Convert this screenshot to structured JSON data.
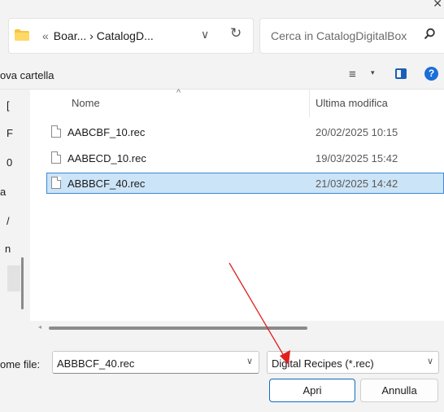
{
  "address": {
    "overflow_glyph": "«",
    "path": "Boar... › CatalogD...",
    "dropdown_glyph": "∨",
    "refresh_glyph": "↻"
  },
  "search": {
    "placeholder": "Cerca in CatalogDigitalBox",
    "icon": "search-icon"
  },
  "toolbar": {
    "new_folder_label": "ova cartella",
    "view_glyph": "≡",
    "view_dropdown_glyph": "▾",
    "help_glyph": "?"
  },
  "nav": {
    "items": [
      "[",
      "F",
      "0",
      "a",
      "/",
      "n"
    ]
  },
  "columns": {
    "name": "Nome",
    "date": "Ultima modifica",
    "sort_glyph": "^"
  },
  "files": [
    {
      "name": "AABCBF_10.rec",
      "date": "20/02/2025 10:15",
      "selected": false
    },
    {
      "name": "AABECD_10.rec",
      "date": "19/03/2025 15:42",
      "selected": false
    },
    {
      "name": "ABBBCF_40.rec",
      "date": "21/03/2025 14:42",
      "selected": true
    }
  ],
  "scroll": {
    "left_glyph": "◂"
  },
  "footer": {
    "file_name_label": "ome file:",
    "file_name_value": "ABBBCF_40.rec",
    "file_type_value": "Digital Recipes (*.rec)",
    "dropdown_glyph": "∨",
    "open_label": "Apri",
    "cancel_label": "Annulla"
  },
  "window": {
    "close_glyph": "✕"
  },
  "colors": {
    "accent": "#0f6cbd",
    "selection": "#cce4f7",
    "annotation_arrow": "#e02020"
  }
}
